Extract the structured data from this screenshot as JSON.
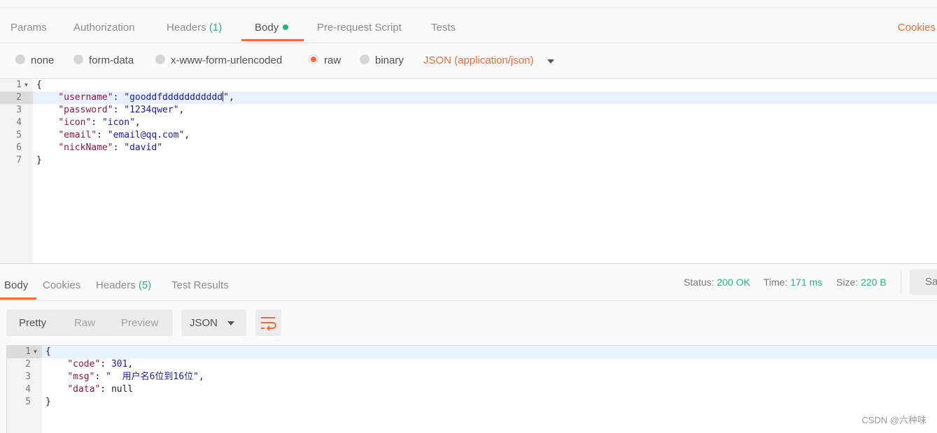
{
  "request_tabs": {
    "params": "Params",
    "authorization": "Authorization",
    "headers": "Headers",
    "headers_count": "(1)",
    "body": "Body",
    "pre_request": "Pre-request Script",
    "tests": "Tests",
    "cookies": "Cookies"
  },
  "body_types": {
    "none": "none",
    "form_data": "form-data",
    "urlencoded": "x-www-form-urlencoded",
    "raw": "raw",
    "binary": "binary",
    "selected": "raw",
    "content_type": "JSON (application/json)"
  },
  "request_body": {
    "line_numbers": [
      "1",
      "2",
      "3",
      "4",
      "5",
      "6",
      "7"
    ],
    "lines": [
      "{",
      "    \"username\": \"gooddfddddddddddd\",",
      "    \"password\": \"1234qwer\",",
      "    \"icon\": \"icon\",",
      "    \"email\": \"email@qq.com\",",
      "    \"nickName\": \"david\"",
      "}"
    ],
    "fields": [
      {
        "key": "\"username\"",
        "value": "\"gooddfddddddddddd\""
      },
      {
        "key": "\"password\"",
        "value": "\"1234qwer\""
      },
      {
        "key": "\"icon\"",
        "value": "\"icon\""
      },
      {
        "key": "\"email\"",
        "value": "\"email@qq.com\""
      },
      {
        "key": "\"nickName\"",
        "value": "\"david\""
      }
    ],
    "highlighted_line": 2
  },
  "response_tabs": {
    "body": "Body",
    "cookies": "Cookies",
    "headers": "Headers",
    "headers_count": "(5)",
    "test_results": "Test Results"
  },
  "response_status": {
    "status_label": "Status:",
    "status_value": "200 OK",
    "time_label": "Time:",
    "time_value": "171 ms",
    "size_label": "Size:",
    "size_value": "220 B",
    "save_label": "Sav"
  },
  "view_modes": {
    "pretty": "Pretty",
    "raw": "Raw",
    "preview": "Preview",
    "format": "JSON"
  },
  "response_body": {
    "line_numbers": [
      "1",
      "2",
      "3",
      "4",
      "5"
    ],
    "code_key": "\"code\"",
    "code_value": "301",
    "msg_key": "\"msg\"",
    "msg_value": "\"  用户名6位到16位\"",
    "data_key": "\"data\"",
    "data_value": "null"
  },
  "watermark": "CSDN @六种味",
  "colors": {
    "accent": "#f26b3a",
    "success": "#26b47f",
    "json_key": "#8b1a3e",
    "json_string": "#1a1aa6"
  }
}
